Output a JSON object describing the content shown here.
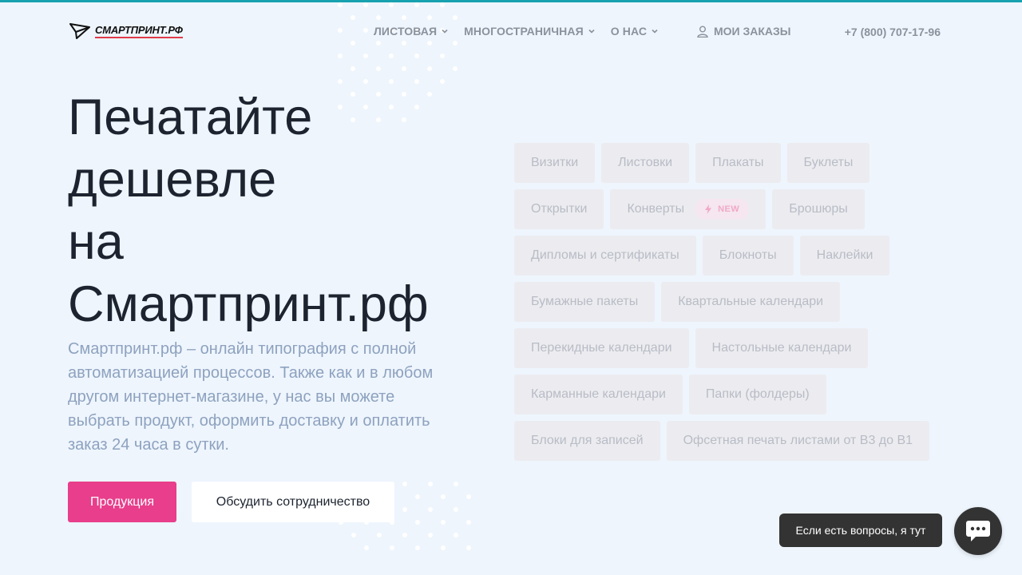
{
  "brand": {
    "name": "СМАРТПРИНТ.РФ",
    "accent": "#e83e8c",
    "topline": "#17a2b0"
  },
  "nav": {
    "items": [
      {
        "label": "ЛИСТОВАЯ",
        "has_dropdown": true
      },
      {
        "label": "МНОГОСТРАНИЧНАЯ",
        "has_dropdown": true
      },
      {
        "label": "О НАС",
        "has_dropdown": true
      }
    ],
    "orders_label": "МОИ ЗАКАЗЫ",
    "phone": "+7 (800) 707-17-96"
  },
  "hero": {
    "title_lines": [
      "Печатайте",
      "дешевле",
      "на",
      "Смартпринт.рф"
    ],
    "description": "Смартпринт.рф – онлайн типография с полной автоматизацией процессов. Также как и в любом другом интернет-магазине, у нас вы можете выбрать продукт, оформить доставку и оплатить заказ 24 часа в сутки.",
    "primary_button": "Продукция",
    "secondary_button": "Обсудить сотрудничество"
  },
  "products": {
    "rows": [
      [
        "Визитки",
        "Листовки",
        "Плакаты",
        "Буклеты"
      ],
      [
        "Открытки",
        "Конверты",
        "Брошюры"
      ],
      [
        "Дипломы и сертификаты",
        "Блокноты",
        "Наклейки"
      ],
      [
        "Бумажные пакеты",
        "Квартальные календари"
      ],
      [
        "Перекидные календари",
        "Настольные календари"
      ],
      [
        "Карманные календари",
        "Папки (фолдеры)"
      ],
      [
        "Блоки для записей",
        "Офсетная печать листами от В3 до В1"
      ]
    ],
    "new_badge": "NEW",
    "new_item": "Конверты"
  },
  "chat": {
    "bubble_text": "Если есть вопросы, я тут"
  }
}
